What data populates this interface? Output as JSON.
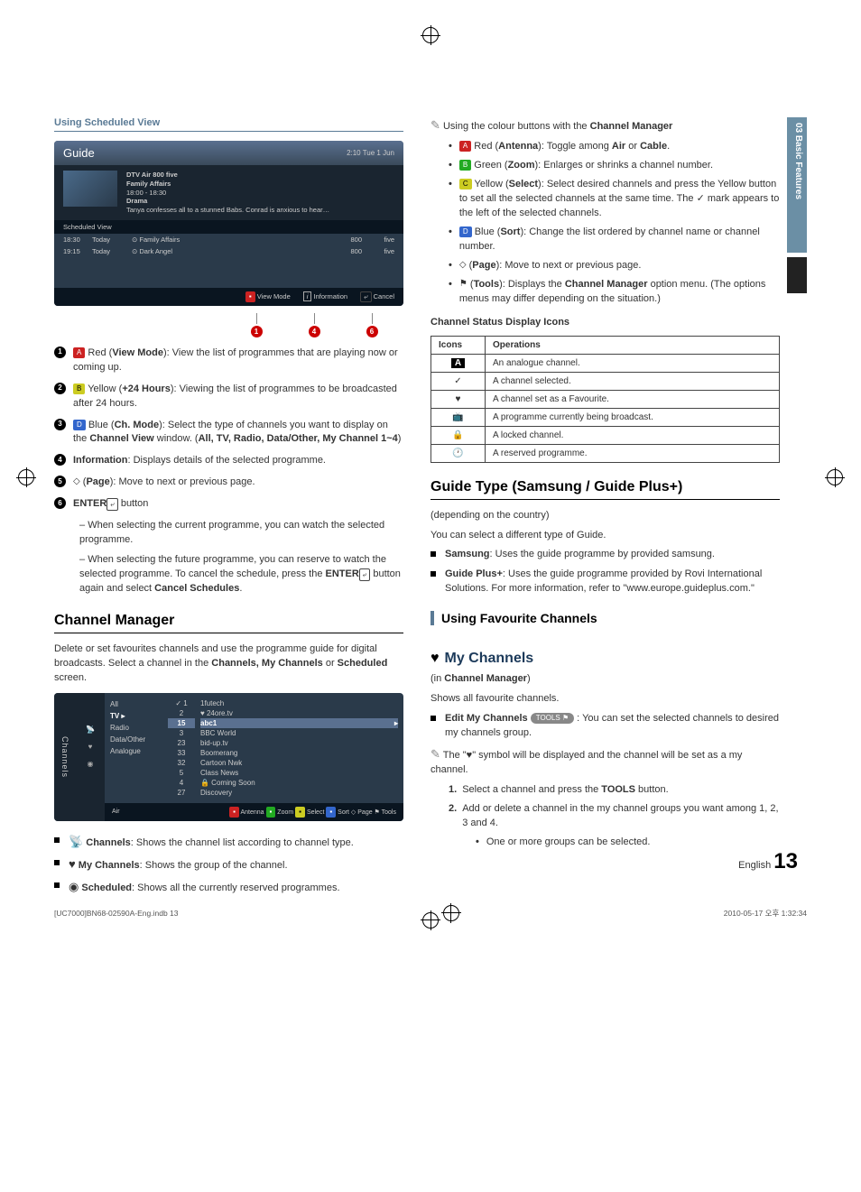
{
  "side_tab": "03    Basic Features",
  "left": {
    "sched_title": "Using Scheduled View",
    "guide": {
      "title": "Guide",
      "clock": "2:10 Tue 1 Jun",
      "meta1": "DTV Air 800 five",
      "meta2": "Family Affairs",
      "meta3": "18:00 - 18:30",
      "meta4": "Drama",
      "meta5": "Tanya confesses all to a stunned Babs. Conrad is anxious to hear…",
      "sv": "Scheduled View",
      "rows": [
        {
          "t": "18:30",
          "d": "Today",
          "p": "Family Affairs",
          "n": "800",
          "c": "five",
          "rec": "⊙"
        },
        {
          "t": "19:15",
          "d": "Today",
          "p": "Dark Angel",
          "n": "800",
          "c": "five",
          "rec": "⊙"
        }
      ],
      "foot": {
        "vm": "View Mode",
        "info": "Information",
        "cancel": "Cancel"
      }
    },
    "callout_nums": [
      "1",
      "4",
      "6"
    ],
    "items": [
      {
        "n": "1",
        "html": [
          {
            "type": "badge",
            "cls": "red",
            "t": "A"
          },
          {
            "t": " Red ("
          },
          {
            "b": "View Mode"
          },
          {
            "t": "): View the list of programmes that are playing now or coming up."
          }
        ]
      },
      {
        "n": "2",
        "html": [
          {
            "type": "badge",
            "cls": "yellow",
            "t": "B"
          },
          {
            "t": " Yellow ("
          },
          {
            "b": "+24 Hours"
          },
          {
            "t": "): Viewing the list of programmes to be broadcasted after 24 hours."
          }
        ]
      },
      {
        "n": "3",
        "html": [
          {
            "type": "badge",
            "cls": "blue",
            "t": "D"
          },
          {
            "t": " Blue ("
          },
          {
            "b": "Ch. Mode"
          },
          {
            "t": "): Select the type of channels you want to display on the "
          },
          {
            "b": "Channel View"
          },
          {
            "t": " window. ("
          },
          {
            "b": "All, TV, Radio, Data/Other, My Channel 1~4"
          },
          {
            "t": ")"
          }
        ]
      },
      {
        "n": "4",
        "html": [
          {
            "b": "Information"
          },
          {
            "t": ": Displays details of the selected programme."
          }
        ]
      },
      {
        "n": "5",
        "html": [
          {
            "type": "updn"
          },
          {
            "t": " ("
          },
          {
            "b": "Page"
          },
          {
            "t": "):"
          },
          {
            "t": " Move to next or previous page."
          }
        ]
      },
      {
        "n": "6",
        "html": [
          {
            "b": "ENTER"
          },
          {
            "type": "enter"
          },
          {
            "t": " button"
          }
        ]
      }
    ],
    "dashes": [
      "When selecting the current programme, you can watch the selected programme.",
      "When selecting the future programme, you can reserve to watch the selected programme. To cancel the schedule, press the ENTER button again and select Cancel Schedules."
    ],
    "ch_mgr_title": "Channel Manager",
    "ch_mgr_para": "Delete or set favourites channels and use the programme guide for digital broadcasts. Select a channel in the Channels, My Channels or Scheduled screen.",
    "ch_box": {
      "side": "Channels",
      "cats": [
        "All",
        "TV",
        "Radio",
        "Data/Other",
        "Analogue"
      ],
      "top_nums": [
        "✓ 1",
        "2"
      ],
      "top_names": [
        "1futech",
        "♥ 24ore.tv"
      ],
      "sel_num": "15",
      "sel_name": "abc1",
      "nums": [
        "3",
        "23",
        "33",
        "32",
        "5",
        "4",
        "27"
      ],
      "names": [
        "BBC World",
        "bid-up.tv",
        "Boomerang",
        "Cartoon Nwk",
        "Class News",
        "Coming Soon",
        "Discovery"
      ],
      "foot_left": "Air",
      "foot_right": "Antenna   Zoom   Select   Sort   Page   Tools"
    },
    "legend": [
      {
        "icon": "ch",
        "b": "Channels",
        "t": ": Shows the channel list according to channel type."
      },
      {
        "icon": "heart",
        "b": "My Channels",
        "t": ": Shows the group of the channel."
      },
      {
        "icon": "sched",
        "b": "Scheduled",
        "t": ": Shows all the currently reserved programmes."
      }
    ]
  },
  "right": {
    "note1": "Using the colour buttons with the Channel Manager",
    "bullets": [
      [
        {
          "type": "badge",
          "cls": "red",
          "t": "A"
        },
        {
          "t": " Red ("
        },
        {
          "b": "Antenna"
        },
        {
          "t": "): Toggle among "
        },
        {
          "b": "Air"
        },
        {
          "t": " or "
        },
        {
          "b": "Cable"
        },
        {
          "t": "."
        }
      ],
      [
        {
          "type": "badge",
          "cls": "green",
          "t": "B"
        },
        {
          "t": " Green ("
        },
        {
          "b": "Zoom"
        },
        {
          "t": "): Enlarges or shrinks a channel number."
        }
      ],
      [
        {
          "type": "badge",
          "cls": "yellow",
          "t": "C"
        },
        {
          "t": " Yellow ("
        },
        {
          "b": "Select"
        },
        {
          "t": "): Select desired channels and press the Yellow button to set all the selected channels at the same time. The ✓ mark appears to the left of the selected channels."
        }
      ],
      [
        {
          "type": "badge",
          "cls": "blue",
          "t": "D"
        },
        {
          "t": " Blue ("
        },
        {
          "b": "Sort"
        },
        {
          "t": "): Change the list ordered by channel name or channel number."
        }
      ],
      [
        {
          "type": "updn"
        },
        {
          "t": " ("
        },
        {
          "b": "Page"
        },
        {
          "t": "): Move to next or previous page."
        }
      ],
      [
        {
          "type": "tools"
        },
        {
          "t": " ("
        },
        {
          "b": "Tools"
        },
        {
          "t": "): Displays the "
        },
        {
          "b": "Channel Manager"
        },
        {
          "t": " option menu. (The options menus may differ depending on the situation.)"
        }
      ]
    ],
    "csdi_title": "Channel Status Display Icons",
    "tbl_head": [
      "Icons",
      "Operations"
    ],
    "tbl_rows": [
      {
        "i": "A",
        "t": "An analogue channel."
      },
      {
        "i": "✓",
        "t": "A channel selected."
      },
      {
        "i": "♥",
        "t": "A channel set as a Favourite."
      },
      {
        "i": "▢",
        "t": "A programme currently being broadcast."
      },
      {
        "i": "🔒",
        "t": "A locked channel."
      },
      {
        "i": "⏲",
        "t": "A reserved programme."
      }
    ],
    "guide_type_title": "Guide Type (Samsung / Guide Plus+)",
    "guide_type_sub": "(depending on the country)",
    "guide_type_p": "You can select a different type of Guide.",
    "gt_items": [
      {
        "b": "Samsung",
        "t": ": Uses the guide programme by provided samsung."
      },
      {
        "b": "Guide Plus+",
        "t": ": Uses the guide programme provided by Rovi International Solutions. For more information, refer to \"www.europe.guideplus.com.\""
      }
    ],
    "fav_title": "Using Favourite Channels",
    "mych_title": "My Channels",
    "mych_sub": "(in Channel Manager)",
    "mych_p": "Shows all favourite channels.",
    "edit_item": {
      "b": "Edit My Channels",
      "pill": "TOOLS",
      "t": " : You can set the selected channels to desired my channels group."
    },
    "note2": "The \"♥\" symbol will be displayed and the channel will be set as a my channel.",
    "steps": [
      {
        "n": "1.",
        "t": "Select a channel and press the TOOLS button."
      },
      {
        "n": "2.",
        "t": "Add or delete a channel in the my channel groups you want among 1, 2, 3 and 4."
      }
    ],
    "sub_bullet": "One or more groups can be selected.",
    "page_lang": "English",
    "page_num": "13"
  },
  "footer": {
    "left": "[UC7000]BN68-02590A-Eng.indb   13",
    "right": "2010-05-17   오후 1:32:34"
  }
}
